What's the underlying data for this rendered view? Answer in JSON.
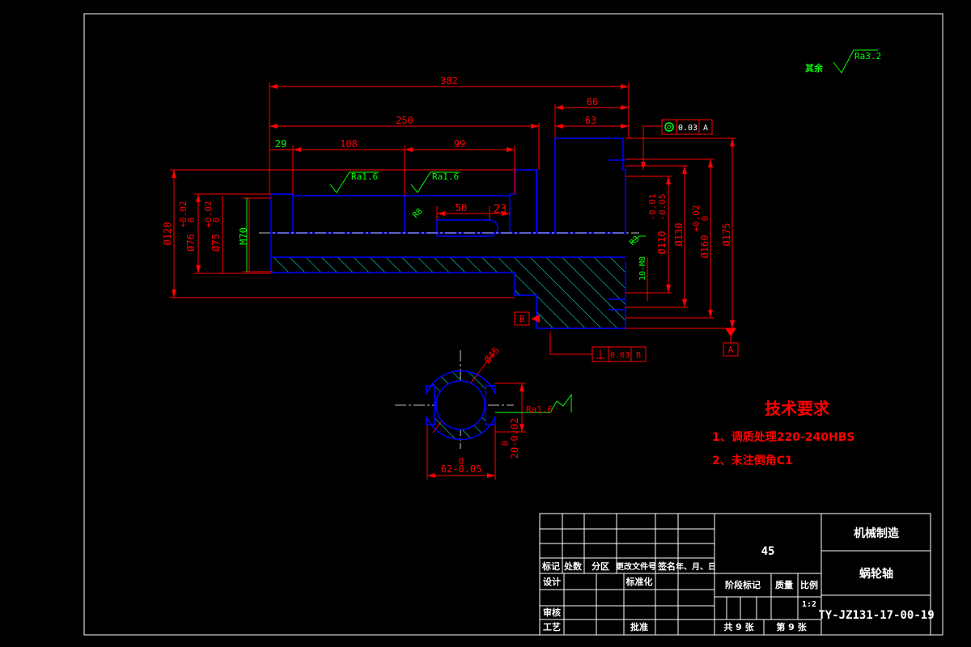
{
  "colors": {
    "background": "#000000",
    "frame": "#ffffff",
    "part_outline": "#0000ff",
    "dimension": "#ff0000",
    "hatch": "#00ffff",
    "annotation": "#00ff00",
    "center_line": "#ffffff"
  },
  "dimensions": {
    "len_total": "382",
    "len_250": "250",
    "len_66": "66",
    "len_63": "63",
    "len_29": "29",
    "len_108": "108",
    "len_99": "99",
    "len_50": "50",
    "len_23": "23",
    "dia_120": "Ø120",
    "dia_76": "Ø76",
    "dia_76_tol_upper": "+0.02",
    "dia_76_tol_lower": "0",
    "dia_75": "Ø75",
    "dia_75_tol_upper": "+0.02",
    "dia_75_tol_lower": "0",
    "thread": "M70",
    "dia_110": "Ø110",
    "dia_110_tol_upper": "-0.01",
    "dia_110_tol_lower": "-0.05",
    "dia_130": "Ø130",
    "dia_160": "Ø160",
    "dia_160_tol_upper": "+0.02",
    "dia_160_tol_lower": "0",
    "dia_175": "Ø175",
    "groove": "10-M8",
    "chamfer_r": "R8",
    "chamfer_r2": "R3",
    "section_dia": "Ø45",
    "key_width": "62-0.05",
    "key_width_upper": "0",
    "key_depth": "20-0.02",
    "key_depth_upper": "0",
    "key_bottom": "0"
  },
  "roughness": {
    "general_label": "其余",
    "general_value": "Ra3.2",
    "r1": "Ra1.6",
    "r2": "Ra1.6",
    "r3": "Ra1.6"
  },
  "tolerances": {
    "concentricity_value": "0.03",
    "concentricity_datum": "A",
    "perpendicularity_value": "0.03",
    "perpendicularity_datum": "B",
    "datum_a": "A",
    "datum_b": "B"
  },
  "tech_requirements": {
    "title": "技术要求",
    "items": [
      "1、调质处理220-240HBS",
      "2、未注倒角C1"
    ]
  },
  "title_block": {
    "material": "45",
    "company": "机械制造",
    "part_name": "蜗轮轴",
    "drawing_no": "TY-JZ131-17-00-19",
    "headers": [
      "标记",
      "处数",
      "分区",
      "更改文件号",
      "签名",
      "年、月、日"
    ],
    "design": "设计",
    "standardize": "标准化",
    "review": "审核",
    "process": "工艺",
    "approve": "批准",
    "stage_mark": "阶段标记",
    "weight": "质量",
    "scale_label": "比例",
    "scale": "1:2",
    "sheets_total": "共 9 张",
    "sheet_no": "第 9 张"
  }
}
